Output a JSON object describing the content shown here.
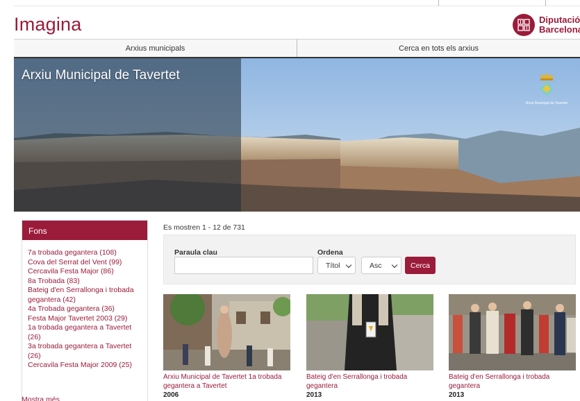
{
  "header": {
    "logo": "Imagina",
    "diputacio_line1": "Diputació",
    "diputacio_line2": "Barcelona"
  },
  "nav": {
    "tabs": [
      {
        "label": "Arxius municipals"
      },
      {
        "label": "Cerca en tots els arxius"
      }
    ]
  },
  "hero": {
    "title": "Arxiu Municipal de Tavertet",
    "archive_logo_caption": "Arxiu Municipal de Tavertet"
  },
  "fons": {
    "heading": "Fons",
    "items": [
      {
        "label": "7a trobada gegantera (108)"
      },
      {
        "label": "Cova del Serrat del Vent (99)"
      },
      {
        "label": "Cercavila Festa Major (86)"
      },
      {
        "label": "8a Trobada (83)"
      },
      {
        "label": "Bateig d'en Serrallonga i trobada gegantera (42)"
      },
      {
        "label": "4a Trobada gegantera (36)"
      },
      {
        "label": "Festa Major Tavertet 2003 (29)"
      },
      {
        "label": "1a trobada gegantera a Tavertet (26)"
      },
      {
        "label": "3a trobada gegantera a Tavertet (26)"
      },
      {
        "label": "Cercavila Festa Major 2009 (25)"
      }
    ],
    "more_link": "Mostra més"
  },
  "results": {
    "count_text": "Es mostren 1 - 12 de 731"
  },
  "search": {
    "keyword_label": "Paraula clau",
    "keyword_value": "",
    "order_label": "Ordena",
    "order_field": "Títol",
    "order_direction": "Asc",
    "button_label": "Cerca"
  },
  "cards": [
    {
      "title": "Arxiu Municipal de Tavertet 1a trobada gegantera a Tavertet",
      "year": "2006"
    },
    {
      "title": "Bateig d'en Serrallonga i trobada gegantera",
      "year": "2013"
    },
    {
      "title": "Bateig d'en Serrallonga i trobada gegantera",
      "year": "2013"
    }
  ],
  "colors": {
    "brand": "#9b1b3a",
    "search_panel": "#f2f2f2"
  }
}
